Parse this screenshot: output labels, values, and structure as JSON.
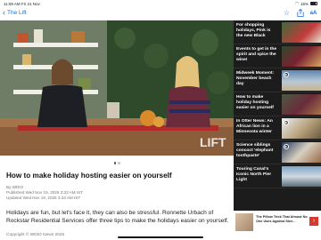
{
  "status_bar": {
    "time": "11:09 AM",
    "date": "Fri 21 Nov",
    "battery": "16%"
  },
  "nav": {
    "back_label": "The Lift"
  },
  "hero": {
    "watermark": "LIFT",
    "active_slide": 1,
    "slide_count": 2
  },
  "article": {
    "title": "How to make holiday hosting easier on yourself",
    "byline": "By WDIO",
    "published": "Published Wed Nov 19, 2025 3:33 AM IST",
    "updated": "Updated Wed Nov 19, 2025 3:33 AM IST",
    "body": "Holidays are fun, but let's face it, they can also be stressful. Ronnette Urbach of Rockstar Residential Services offer three tips to make the holidays easier on yourself.",
    "copyright": "Copyright © WDIO News 2025"
  },
  "sidebar": {
    "items": [
      {
        "title": "For shopping holidays, Pink is the new Black",
        "has_play": false
      },
      {
        "title": "Events to get in the spirit and spice the wine!",
        "has_play": false
      },
      {
        "title": "Midweek Moment: November beach day",
        "has_play": true
      },
      {
        "title": "How to make holiday hosting easier on yourself",
        "has_play": false
      },
      {
        "title": "In Otter News: An African lion in a Minnesota winter",
        "has_play": true
      },
      {
        "title": "Science siblings concoct 'elephant toothpaste'",
        "has_play": true
      },
      {
        "title": "Touring Canal's Iconic North Pier Light",
        "has_play": false
      }
    ]
  },
  "ad": {
    "text": "The Pillow Trick That Almost No One Uses Against Slee..."
  },
  "colors": {
    "accent": "#1a6fd8",
    "sidebar_bg": "#1c1c1c",
    "ad_arrow": "#d63a2f"
  }
}
